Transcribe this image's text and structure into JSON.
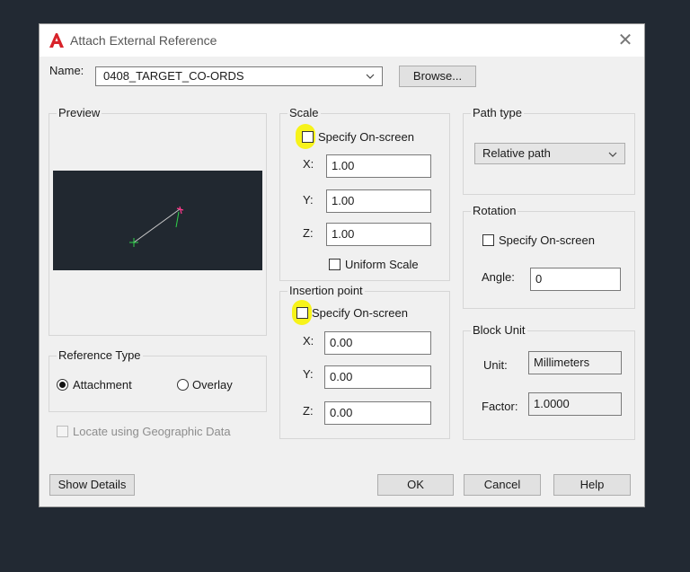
{
  "window": {
    "title": "Attach External Reference",
    "close_glyph": "✕"
  },
  "name_row": {
    "label": "Name:",
    "value": "0408_TARGET_CO-ORDS",
    "browse_label": "Browse..."
  },
  "preview": {
    "title": "Preview"
  },
  "scale": {
    "title": "Scale",
    "specify_label": "Specify On-screen",
    "x_label": "X:",
    "x_value": "1.00",
    "y_label": "Y:",
    "y_value": "1.00",
    "z_label": "Z:",
    "z_value": "1.00",
    "uniform_label": "Uniform Scale"
  },
  "insertion": {
    "title": "Insertion point",
    "specify_label": "Specify On-screen",
    "x_label": "X:",
    "x_value": "0.00",
    "y_label": "Y:",
    "y_value": "0.00",
    "z_label": "Z:",
    "z_value": "0.00"
  },
  "path_type": {
    "title": "Path type",
    "value": "Relative path"
  },
  "rotation": {
    "title": "Rotation",
    "specify_label": "Specify On-screen",
    "angle_label": "Angle:",
    "angle_value": "0"
  },
  "block_unit": {
    "title": "Block Unit",
    "unit_label": "Unit:",
    "unit_value": "Millimeters",
    "factor_label": "Factor:",
    "factor_value": "1.0000"
  },
  "reference_type": {
    "title": "Reference Type",
    "attachment_label": "Attachment",
    "overlay_label": "Overlay",
    "selected": "attachment"
  },
  "geo": {
    "label": "Locate using Geographic Data"
  },
  "footer": {
    "show_details": "Show Details",
    "ok": "OK",
    "cancel": "Cancel",
    "help": "Help"
  },
  "colors": {
    "desktop": "#222933",
    "dialog": "#f0f0f0",
    "highlight": "#f7f31a",
    "autocad_red": "#d8232a",
    "preview_bg": "#212830"
  },
  "icons": {
    "app": "autocad-logo-icon",
    "close": "close-icon",
    "dropdown": "chevron-down-icon"
  }
}
